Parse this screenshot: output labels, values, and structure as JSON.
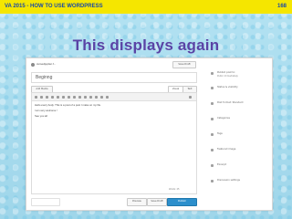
{
  "slide": {
    "header_title": "VA 2015  -  HOW TO USE WORDPRESS",
    "page_number": "168",
    "heading": "This displays again"
  },
  "editor": {
    "author_line": "cursedjupiter.f...",
    "save_draft": "Save Draft",
    "post_title": "Beginng",
    "add_media": "Add Media",
    "tab_visual": "Visual",
    "tab_text": "Text",
    "content_line1": "Hello every body. This is a post of a post I make on my file.",
    "content_line2": "I am very welcome !",
    "content_line3": "See you all",
    "word_count": "Words: 25",
    "preview": "Preview",
    "save_button": "Save Draft",
    "publish_button": "Publish",
    "sidebar": [
      {
        "label": "Publish post to:",
        "sub": "Public Immediately"
      },
      {
        "label": "Status & visibility",
        "sub": ""
      },
      {
        "label": "Post format: Standard",
        "sub": ""
      },
      {
        "label": "Categories",
        "sub": ""
      },
      {
        "label": "Tags",
        "sub": ""
      },
      {
        "label": "Featured image",
        "sub": ""
      },
      {
        "label": "Excerpt",
        "sub": ""
      },
      {
        "label": "Discussion settings",
        "sub": ""
      }
    ]
  }
}
